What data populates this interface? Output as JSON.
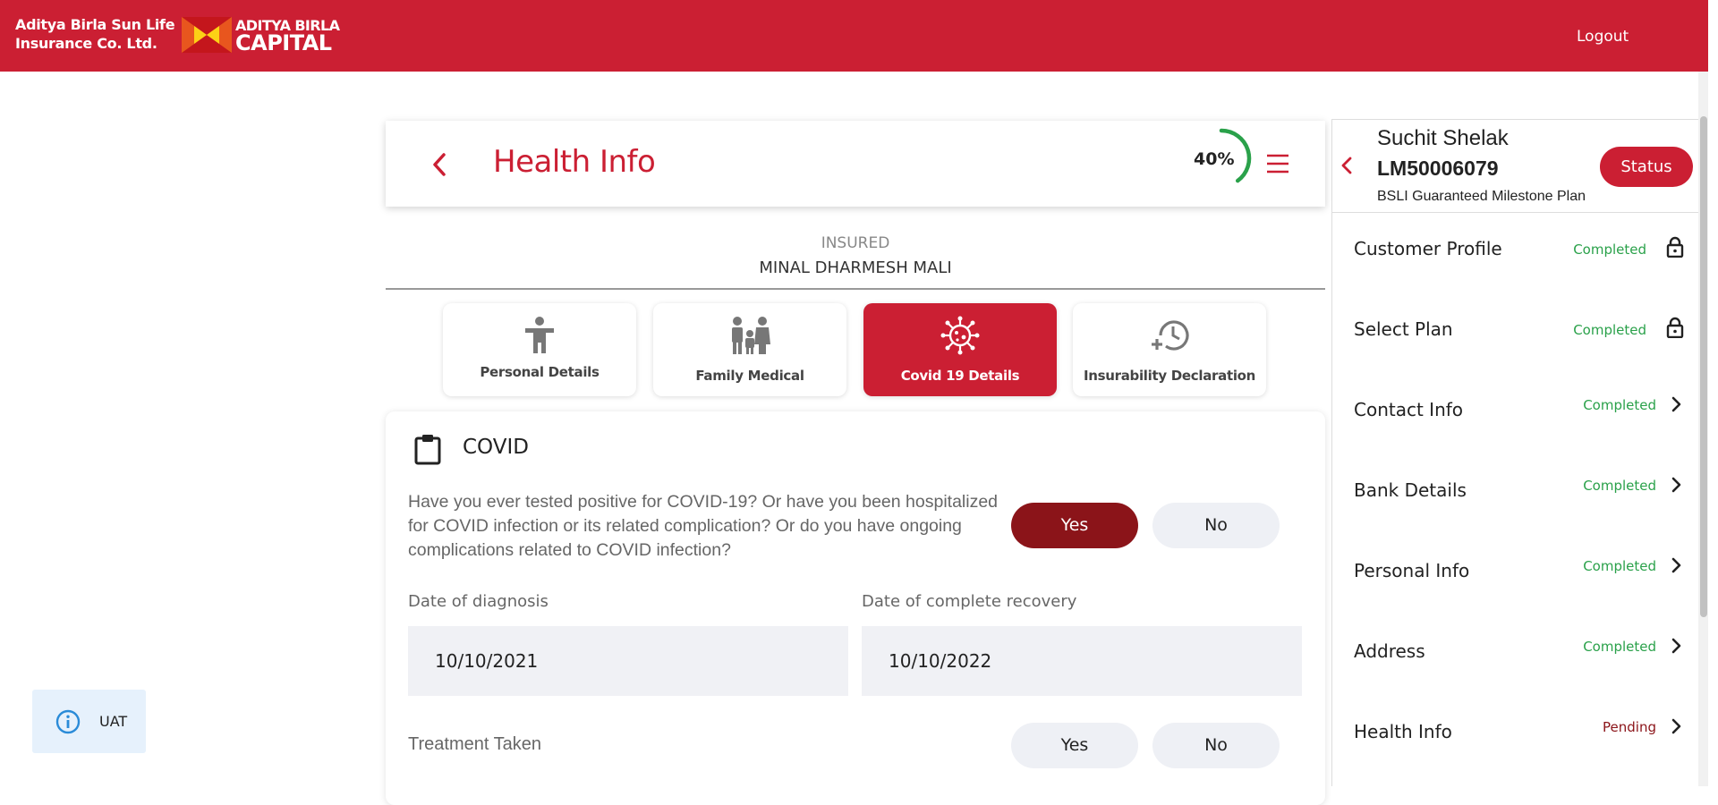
{
  "header": {
    "brand_line1": "Aditya Birla Sun Life",
    "brand_line2": "Insurance Co. Ltd.",
    "logo_top": "ADITYA BIRLA",
    "logo_bottom": "CAPITAL",
    "logout_label": "Logout",
    "brand_color": "#cb1f33"
  },
  "health_card": {
    "title": "Health Info",
    "progress_text": "40%",
    "progress_value": 40,
    "progress_color": "#2aa14a"
  },
  "insured": {
    "label": "INSURED",
    "name": "MINAL DHARMESH MALI"
  },
  "tabs": [
    {
      "label": "Personal Details",
      "icon": "person-icon",
      "active": false
    },
    {
      "label": "Family Medical",
      "icon": "family-icon",
      "active": false
    },
    {
      "label": "Covid 19 Details",
      "icon": "virus-icon",
      "active": true
    },
    {
      "label": "Insurability Declaration",
      "icon": "history-icon",
      "active": false
    }
  ],
  "covid": {
    "title": "COVID",
    "question": "Have you ever tested positive for COVID-19? Or have you been hospitalized for COVID infection or its related complication? Or do you have ongoing complications related to COVID infection?",
    "q_yes": "Yes",
    "q_no": "No",
    "q_selected": "Yes",
    "diagnosis_label": "Date of diagnosis",
    "diagnosis_value": "10/10/2021",
    "recovery_label": "Date of complete recovery",
    "recovery_value": "10/10/2022",
    "treatment_label": "Treatment Taken",
    "treatment_yes": "Yes",
    "treatment_no": "No"
  },
  "uat": {
    "label": "UAT"
  },
  "side": {
    "customer_name": "Suchit Shelak",
    "customer_id": "LM50006079",
    "plan": "BSLI Guaranteed Milestone Plan",
    "status_label": "Status",
    "steps": [
      {
        "label": "Customer Profile",
        "status": "Completed",
        "icon": "lock-icon"
      },
      {
        "label": "Select Plan",
        "status": "Completed",
        "icon": "lock-icon"
      },
      {
        "label": "Contact Info",
        "status": "Completed",
        "icon": "chevron-right-icon"
      },
      {
        "label": "Bank Details",
        "status": "Completed",
        "icon": "chevron-right-icon"
      },
      {
        "label": "Personal Info",
        "status": "Completed",
        "icon": "chevron-right-icon"
      },
      {
        "label": "Address",
        "status": "Completed",
        "icon": "chevron-right-icon"
      },
      {
        "label": "Health Info",
        "status": "Pending",
        "icon": "chevron-right-icon"
      }
    ]
  }
}
